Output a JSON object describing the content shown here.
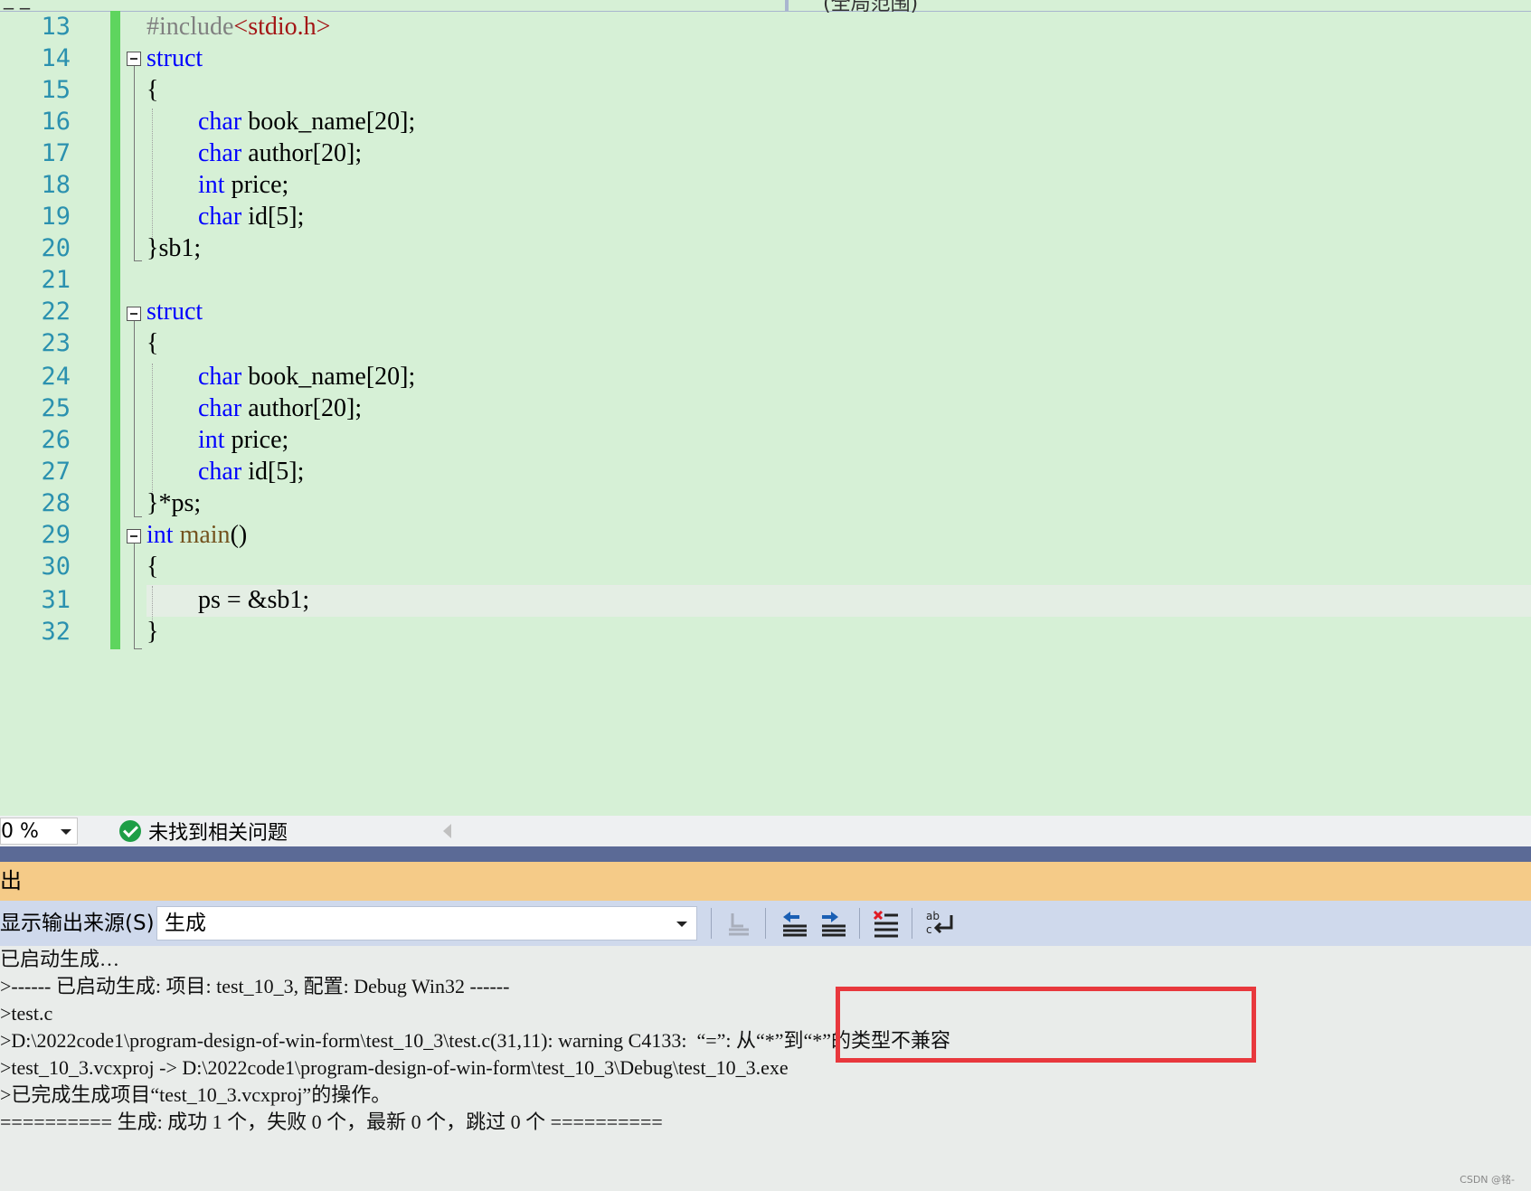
{
  "tabs": {
    "left_fragment": "_ _",
    "right_fragment": "(全局范围)"
  },
  "editor": {
    "line_numbers": [
      "13",
      "14",
      "15",
      "16",
      "17",
      "18",
      "19",
      "20",
      "21",
      "22",
      "23",
      "24",
      "25",
      "26",
      "27",
      "28",
      "29",
      "30",
      "31",
      "32"
    ],
    "code": {
      "l13_pre": "#include",
      "l13_inc": "<stdio.h>",
      "l14": "struct",
      "l15": "{",
      "l16_kw": "char",
      "l16_rest": " book_name[20];",
      "l17_kw": "char",
      "l17_rest": " author[20];",
      "l18_kw": "int",
      "l18_rest": " price;",
      "l19_kw": "char",
      "l19_rest": " id[5];",
      "l20": "}sb1;",
      "l22": "struct",
      "l23": "{",
      "l24_kw": "char",
      "l24_rest": " book_name[20];",
      "l25_kw": "char",
      "l25_rest": " author[20];",
      "l26_kw": "int",
      "l26_rest": " price;",
      "l27_kw": "char",
      "l27_rest": " id[5];",
      "l28": "}*ps;",
      "l29_kw": "int",
      "l29_fn": " main",
      "l29_rest": "()",
      "l30": "{",
      "l31": "ps = &sb1;",
      "l32": "}"
    }
  },
  "statusbar": {
    "zoom": "0 %",
    "issues": "未找到相关问题"
  },
  "output": {
    "title": "出",
    "source_label": "显示输出来源(S):",
    "source_value": "生成",
    "lines": [
      "已启动生成…",
      ">------ 已启动生成: 项目: test_10_3, 配置: Debug Win32 ------",
      ">test.c",
      ">D:\\2022code1\\program-design-of-win-form\\test_10_3\\test.c(31,11): warning C4133:  “=”: 从“*”到“*”的类型不兼容",
      ">test_10_3.vcxproj -> D:\\2022code1\\program-design-of-win-form\\test_10_3\\Debug\\test_10_3.exe",
      ">已完成生成项目“test_10_3.vcxproj”的操作。",
      "========== 生成: 成功 1 个，失败 0 个，最新 0 个，跳过 0 个 =========="
    ],
    "toolbar_icons": [
      "go-to-location-icon",
      "prev-message-icon",
      "next-message-icon",
      "clear-all-icon",
      "word-wrap-icon"
    ]
  },
  "watermark": "CSDN @铭-",
  "colors": {
    "editor_bg": "#d6f0d6",
    "keyword": "#0000ff",
    "line_number": "#2b91af",
    "change_bar": "#5ed55e",
    "output_header": "#f5cb88",
    "highlight_box": "#e8383d"
  }
}
